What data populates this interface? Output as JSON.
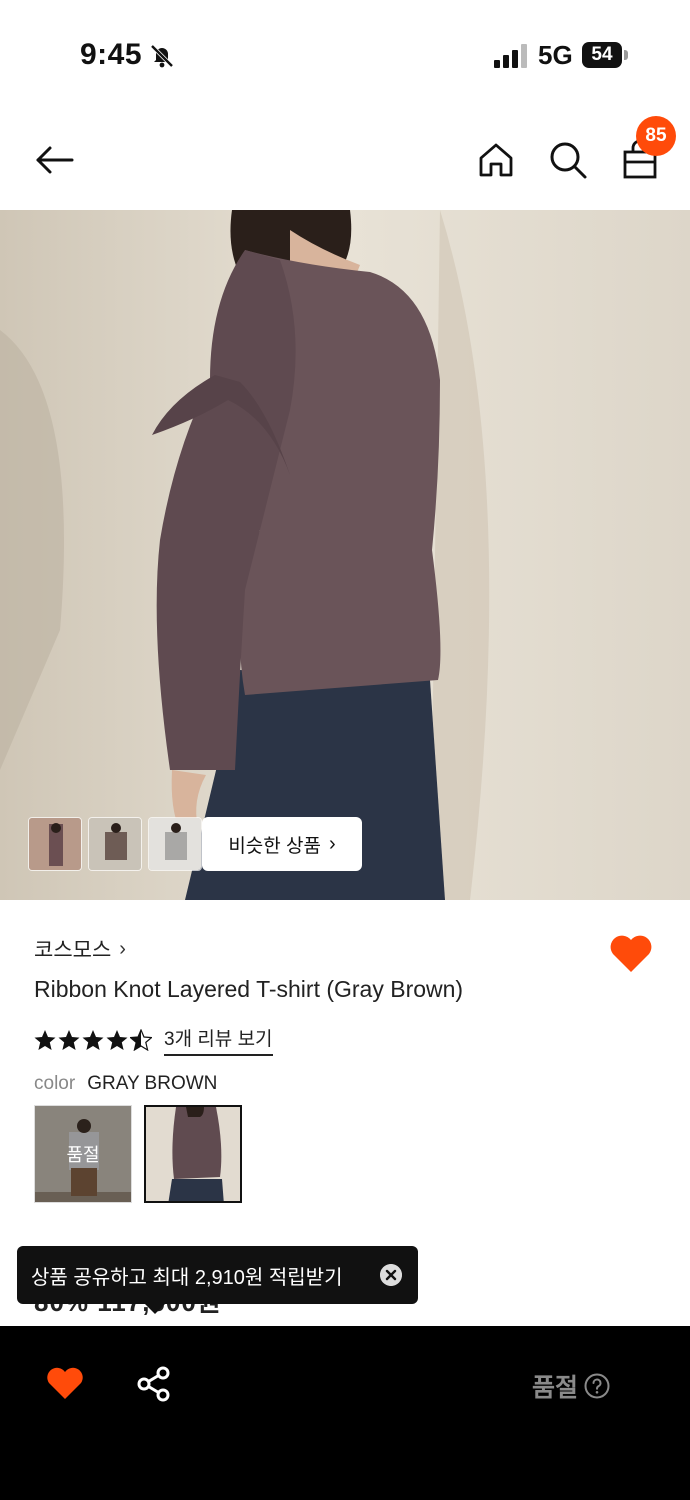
{
  "status_bar": {
    "time": "9:45",
    "network": "5G",
    "battery": "54"
  },
  "header": {
    "cart_count": "85"
  },
  "hero": {
    "similar_label": "비슷한 상품"
  },
  "product": {
    "brand": "코스모스",
    "title": "Ribbon Knot Layered T-shirt (Gray Brown)",
    "rating": 4.5,
    "review_link": "3개 리뷰 보기",
    "color_label": "color",
    "color_value": "GRAY BROWN",
    "swatch_soldout": "품절",
    "price_peek": "80% 117,600원"
  },
  "tooltip": {
    "text": "상품 공유하고 최대 2,910원 적립받기"
  },
  "bottom_bar": {
    "soldout_label": "품절"
  },
  "colors": {
    "accent": "#ff4b0a",
    "dark": "#111111",
    "disabled": "#8a8a8a"
  },
  "icons": [
    "bell-off-icon",
    "signal-icon",
    "back-arrow-icon",
    "home-icon",
    "search-icon",
    "shopping-bag-icon",
    "heart-icon",
    "star-icon",
    "chevron-right-icon",
    "close-icon",
    "share-icon",
    "help-icon"
  ]
}
